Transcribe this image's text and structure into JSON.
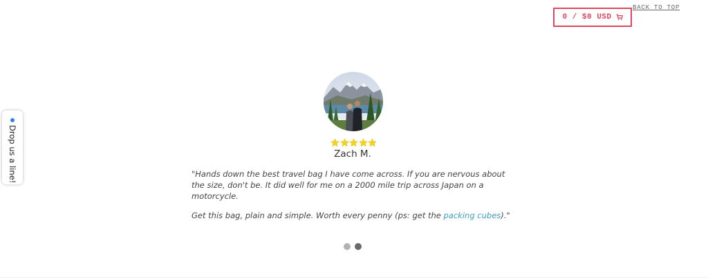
{
  "header": {
    "cart_label": "0 / $0 USD",
    "cart_icon": "shopping-cart-icon",
    "back_to_top": "BACK TO TOP"
  },
  "side_tab": {
    "label": "Drop us a line!",
    "status_color": "#2b82f1"
  },
  "testimonial": {
    "rating": 5,
    "reviewer": "Zach M.",
    "quote_line1": "\"Hands down the best travel bag I have come across. If you are nervous about the size, don't be. It did well for me on a 2000 mile trip across Japan on a motorcycle.",
    "quote_line2_before": "Get this bag, plain and simple. Worth every penny (ps: get the ",
    "quote_link": "packing cubes",
    "quote_line2_after": ").\""
  },
  "carousel": {
    "slides": 2,
    "active_index": 1
  },
  "colors": {
    "accent": "#e0455f",
    "link": "#3b9fc0",
    "star": "#f5d418"
  }
}
